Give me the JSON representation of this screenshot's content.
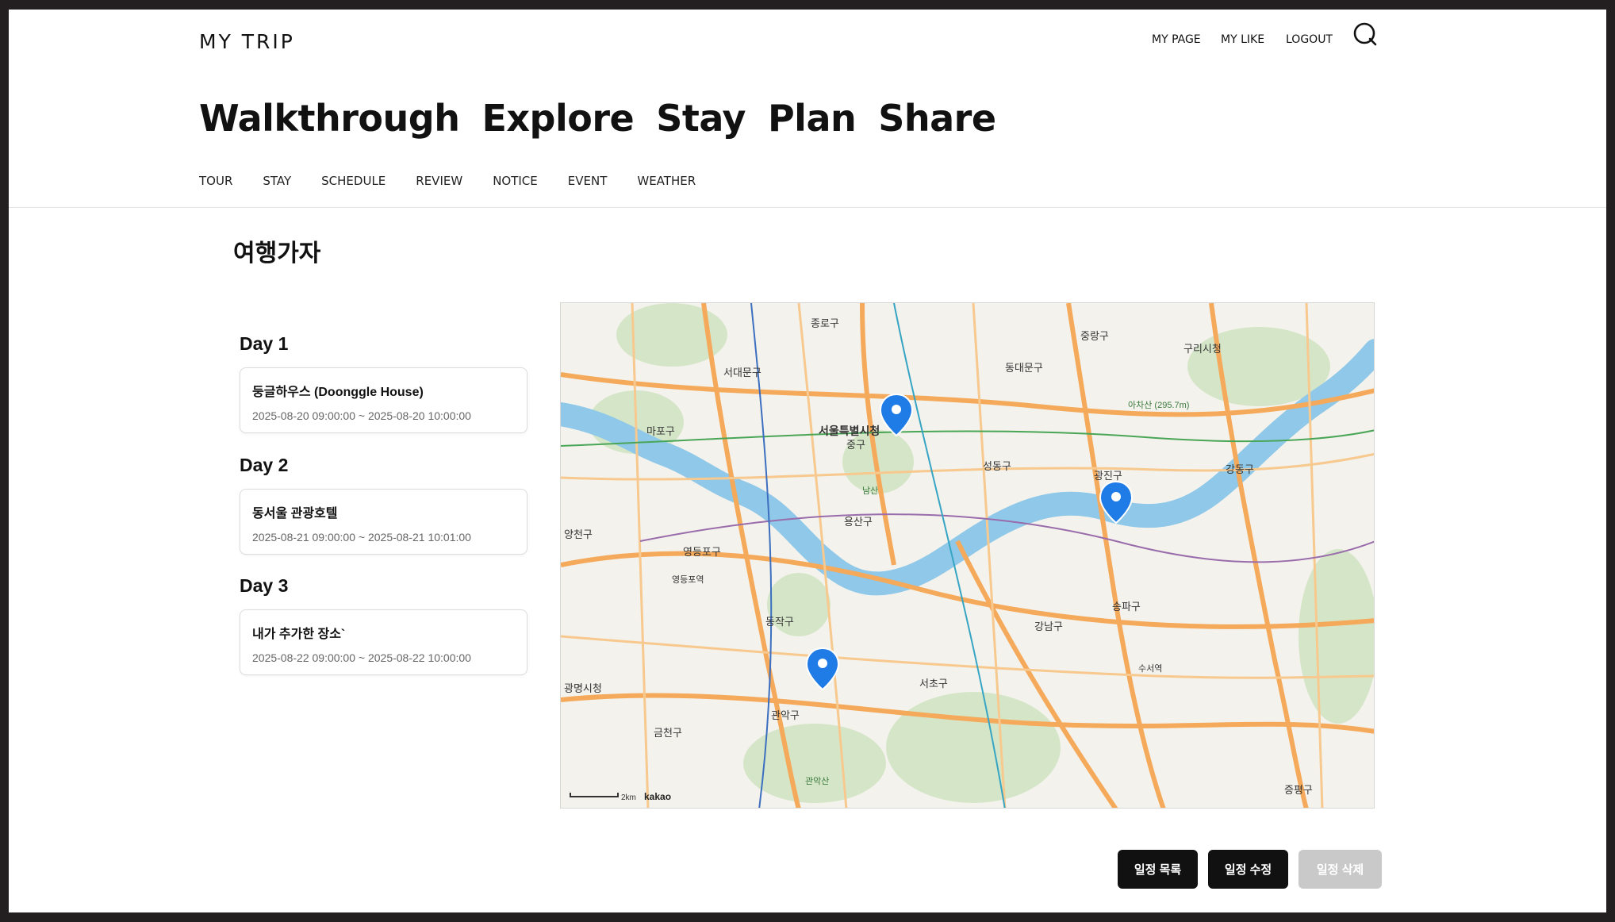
{
  "header": {
    "logo": "MY TRIP",
    "nav": [
      "MY PAGE",
      "MY LIKE",
      "LOGOUT"
    ],
    "search_icon": "search-icon"
  },
  "hero": [
    "Walkthrough",
    "Explore",
    "Stay",
    "Plan",
    "Share"
  ],
  "subnav": [
    "TOUR",
    "STAY",
    "SCHEDULE",
    "REVIEW",
    "NOTICE",
    "EVENT",
    "WEATHER"
  ],
  "trip": {
    "title": "여행가자",
    "days": [
      {
        "label": "Day 1",
        "name": "둥글하우스 (Doonggle House)",
        "time": "2025-08-20 09:00:00 ~ 2025-08-20 10:00:00"
      },
      {
        "label": "Day 2",
        "name": "동서울 관광호텔",
        "time": "2025-08-21 09:00:00 ~ 2025-08-21 10:01:00"
      },
      {
        "label": "Day 3",
        "name": "내가 추가한 장소`",
        "time": "2025-08-22 09:00:00 ~ 2025-08-22 10:00:00"
      }
    ]
  },
  "map": {
    "labels": [
      "종로구",
      "서대문구",
      "동대문구",
      "중랑구",
      "구리시청",
      "서울특별시청",
      "중구",
      "성동구",
      "광진구",
      "강동구",
      "용산구",
      "마포구",
      "영등포구",
      "영등포역",
      "동작구",
      "서초구",
      "강남구",
      "송파구",
      "관악구",
      "금천구",
      "광명시청",
      "양천구",
      "아차산 (295.7m)",
      "남산",
      "관악산",
      "수서역",
      "증평구"
    ],
    "scale": "2km",
    "brand": "kakao",
    "colors": {
      "water": "#8fc8e8",
      "road": "#f5a95a",
      "park": "#cfe3c2",
      "pin": "#1f7be6"
    }
  },
  "actions": {
    "list": "일정 목록",
    "edit": "일정 수정",
    "delete": "일정 삭제"
  }
}
